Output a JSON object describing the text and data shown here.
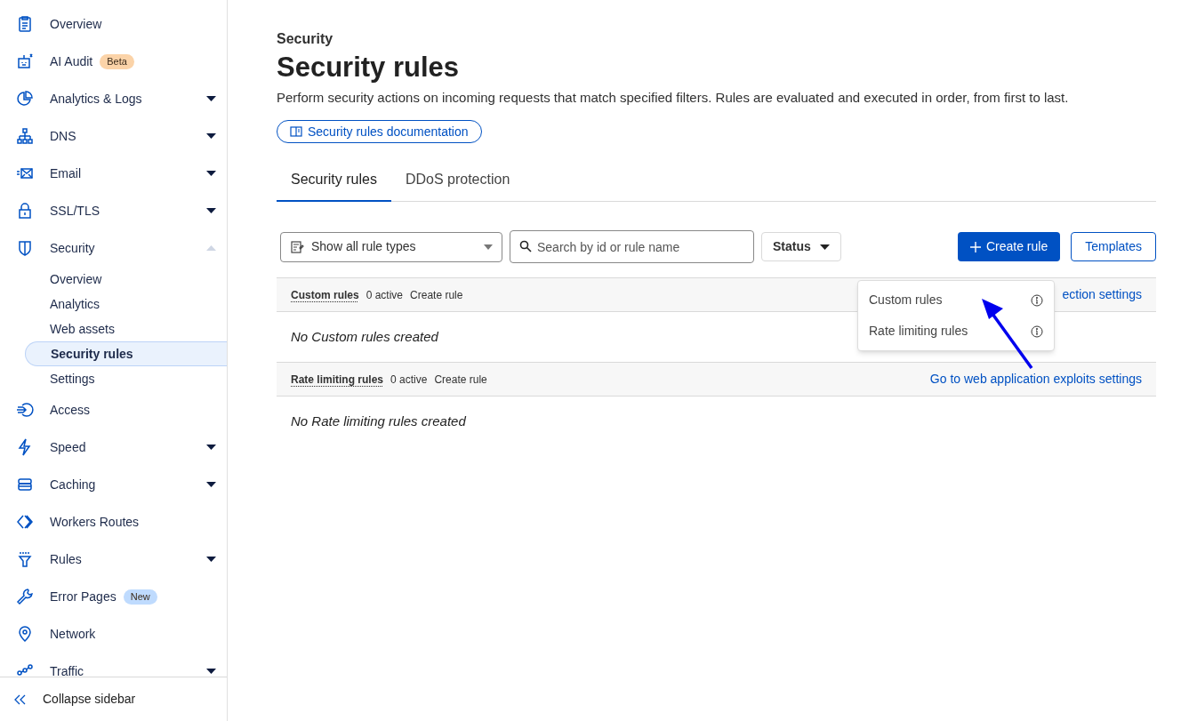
{
  "sidebar": {
    "items": [
      {
        "label": "Overview"
      },
      {
        "label": "AI Audit",
        "badge": {
          "text": "Beta",
          "color": "#fbd3a8"
        }
      },
      {
        "label": "Analytics & Logs",
        "expanded": false
      },
      {
        "label": "DNS",
        "expanded": false
      },
      {
        "label": "Email",
        "expanded": false
      },
      {
        "label": "SSL/TLS",
        "expanded": false
      },
      {
        "label": "Security",
        "expanded": true,
        "children": [
          {
            "label": "Overview",
            "selected": false
          },
          {
            "label": "Analytics",
            "selected": false
          },
          {
            "label": "Web assets",
            "selected": false
          },
          {
            "label": "Security rules",
            "selected": true
          },
          {
            "label": "Settings",
            "selected": false
          }
        ]
      },
      {
        "label": "Access"
      },
      {
        "label": "Speed",
        "expanded": false
      },
      {
        "label": "Caching",
        "expanded": false
      },
      {
        "label": "Workers Routes"
      },
      {
        "label": "Rules",
        "expanded": false
      },
      {
        "label": "Error Pages",
        "badge": {
          "text": "New",
          "color": "#bfdbfe"
        }
      },
      {
        "label": "Network"
      },
      {
        "label": "Traffic",
        "expanded": false
      }
    ],
    "collapse": "Collapse sidebar"
  },
  "page": {
    "breadcrumb": "Security",
    "title": "Security rules",
    "description": "Perform security actions on incoming requests that match specified filters. Rules are evaluated and executed in order, from first to last.",
    "doc_link": "Security rules documentation"
  },
  "tabs": [
    {
      "label": "Security rules",
      "selected": true
    },
    {
      "label": "DDoS protection",
      "selected": false
    }
  ],
  "toolbar": {
    "rule_type": "Show all rule types",
    "search": {
      "placeholder": "Search by id or rule name"
    },
    "status": "Status",
    "create": "Create rule",
    "templates": "Templates"
  },
  "sections": [
    {
      "title": "Custom rules",
      "active": "0 active",
      "create": "Create rule",
      "link": "ection settings",
      "empty": "No Custom rules created"
    },
    {
      "title": "Rate limiting rules",
      "active": "0 active",
      "create": "Create rule",
      "link": "Go to web application exploits settings",
      "empty": "No Rate limiting rules created"
    }
  ],
  "menu": [
    {
      "label": "Custom rules"
    },
    {
      "label": "Rate limiting rules"
    }
  ]
}
